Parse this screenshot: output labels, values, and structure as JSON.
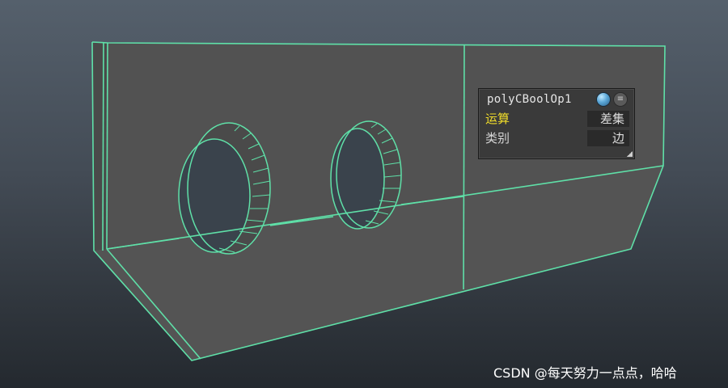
{
  "colors": {
    "wireframe": "#5fe0a8",
    "surface": "#525252",
    "hole": "#3a434c",
    "label_active": "#f1dd2a"
  },
  "hud": {
    "title": "polyCBoolOp1",
    "rows": [
      {
        "label": "运算",
        "value": "差集",
        "active": true
      },
      {
        "label": "类别",
        "value": "边",
        "active": false
      }
    ],
    "icons": {
      "sphere": "sphere-shading-icon",
      "menu": "menu-icon",
      "resize": "resize-grip-icon"
    }
  },
  "watermark": "CSDN @每天努力一点点，哈哈"
}
